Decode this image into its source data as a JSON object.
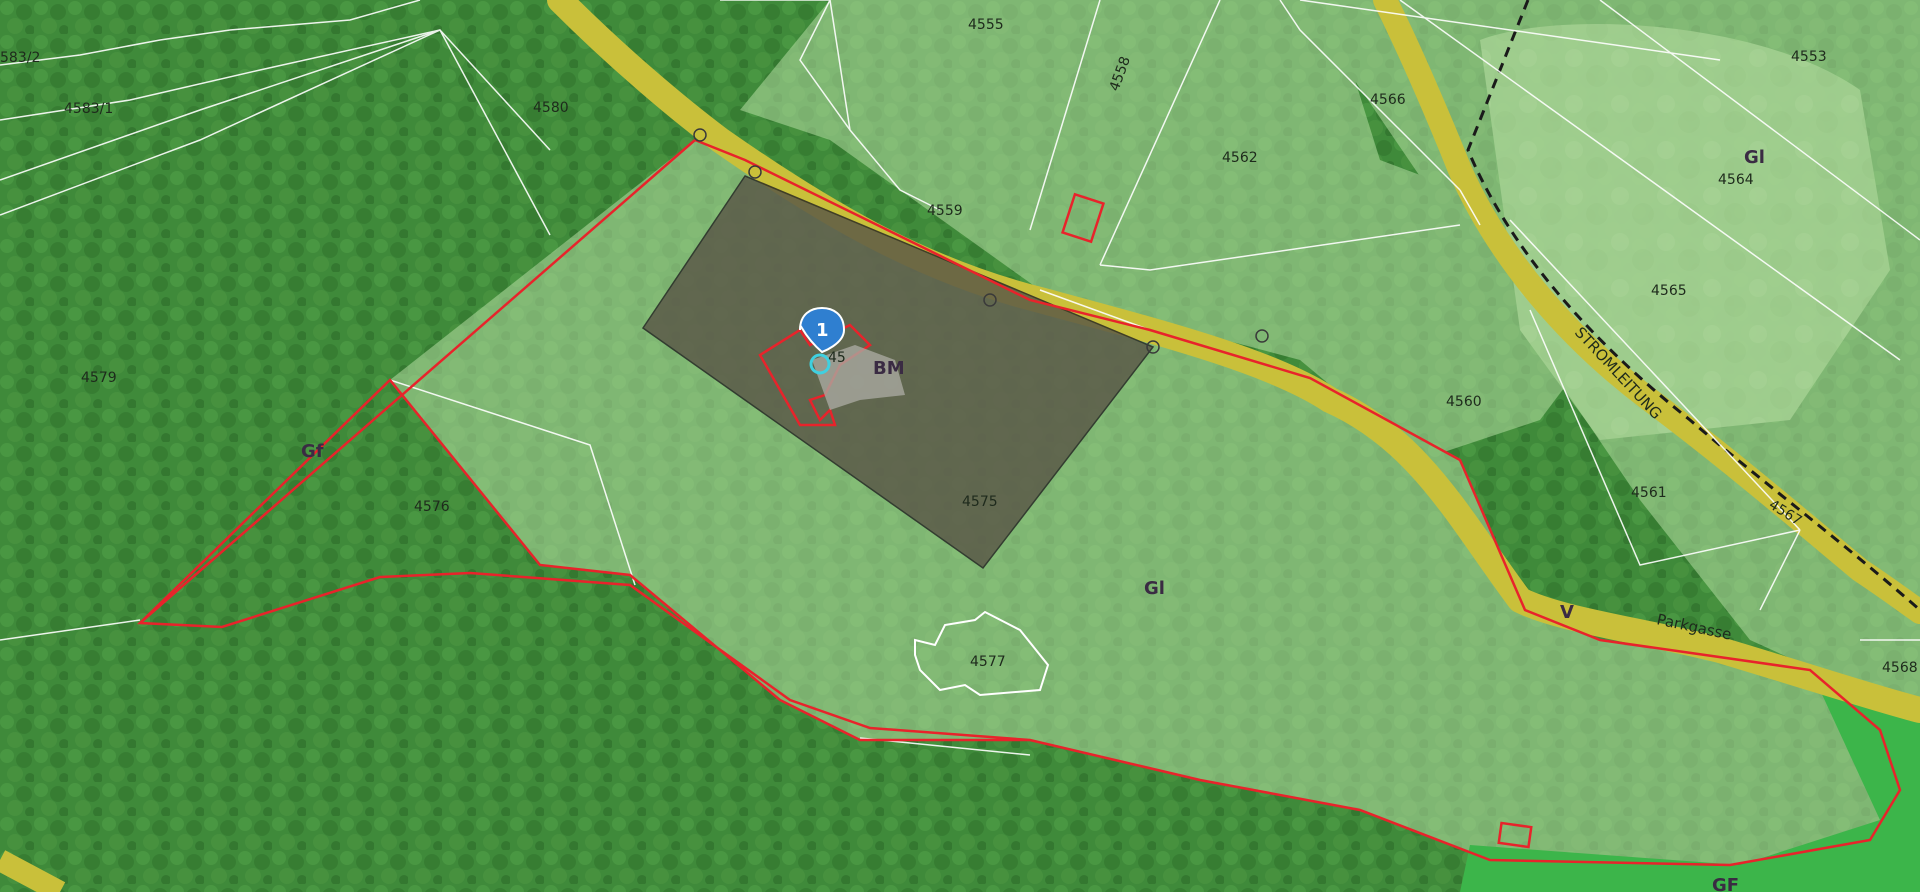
{
  "map": {
    "parcels": {
      "p4583_2": "583/2",
      "p4583_1": "4583/1",
      "p4580": "4580",
      "p4555": "4555",
      "p4558": "4558",
      "p4566": "4566",
      "p4553": "4553",
      "p4562": "4562",
      "p4564": "4564",
      "p4559": "4559",
      "p4565": "4565",
      "p4579": "4579",
      "p4560": "4560",
      "p4561": "4561",
      "p4576": "4576",
      "p4575": "4575",
      "p4567": "4567",
      "p4577": "4577",
      "p4568": "4568",
      "building_no": "45"
    },
    "zones": {
      "gl_top_right": "Gl",
      "gf_left": "Gf",
      "bm": "BM",
      "gl_center": "Gl",
      "v": "V",
      "gf_bottom_right": "GF"
    },
    "streets": {
      "parkgasse": "Parkgasse",
      "stromleitung": "STROMLEITUNG"
    },
    "marker": {
      "number": "1",
      "color": "#2f7fd0"
    },
    "colors": {
      "forest": "#3f8a3a",
      "light_zone": "#a9d396",
      "road": "#c9c03a",
      "bm_zone": "#5d5a4a",
      "boundary_red": "#e8232b",
      "bright_green": "#39b54a"
    }
  }
}
